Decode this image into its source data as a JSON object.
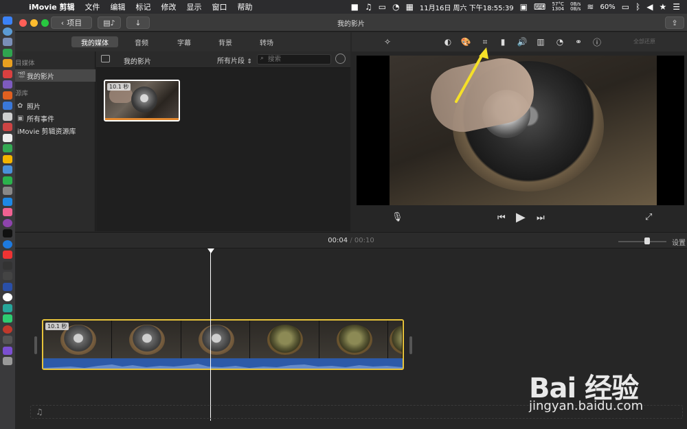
{
  "menubar": {
    "app_name": "iMovie 剪辑",
    "items": [
      "文件",
      "编辑",
      "标记",
      "修改",
      "显示",
      "窗口",
      "帮助"
    ],
    "temp": "57°C",
    "rpm": "1304",
    "net_up": "0B/s",
    "net_down": "0B/s",
    "datetime": "11月16日 周六 下午18:55:39",
    "battery": "60%"
  },
  "titlebar": {
    "back_label": "项目",
    "title": "我的影片"
  },
  "tabs": [
    "我的媒体",
    "音频",
    "字幕",
    "背景",
    "转场"
  ],
  "sidebar": {
    "project_media_header": "目媒体",
    "project_item": "我的影片",
    "libraries_header": "源库",
    "photos": "照片",
    "all_events": "所有事件",
    "library": "iMovie 剪辑资源库"
  },
  "browser": {
    "title": "我的影片",
    "filter": "所有片段",
    "search_placeholder": "搜索",
    "clip_duration": "10.1 秒"
  },
  "viewer": {
    "reset_all": "全部还原"
  },
  "timeline": {
    "current": "00:04",
    "separator": "/",
    "total": "00:10",
    "settings": "设置",
    "clip_duration": "10.1 秒"
  },
  "watermark": {
    "logo": "Bai 经验",
    "url": "jingyan.baidu.com"
  }
}
